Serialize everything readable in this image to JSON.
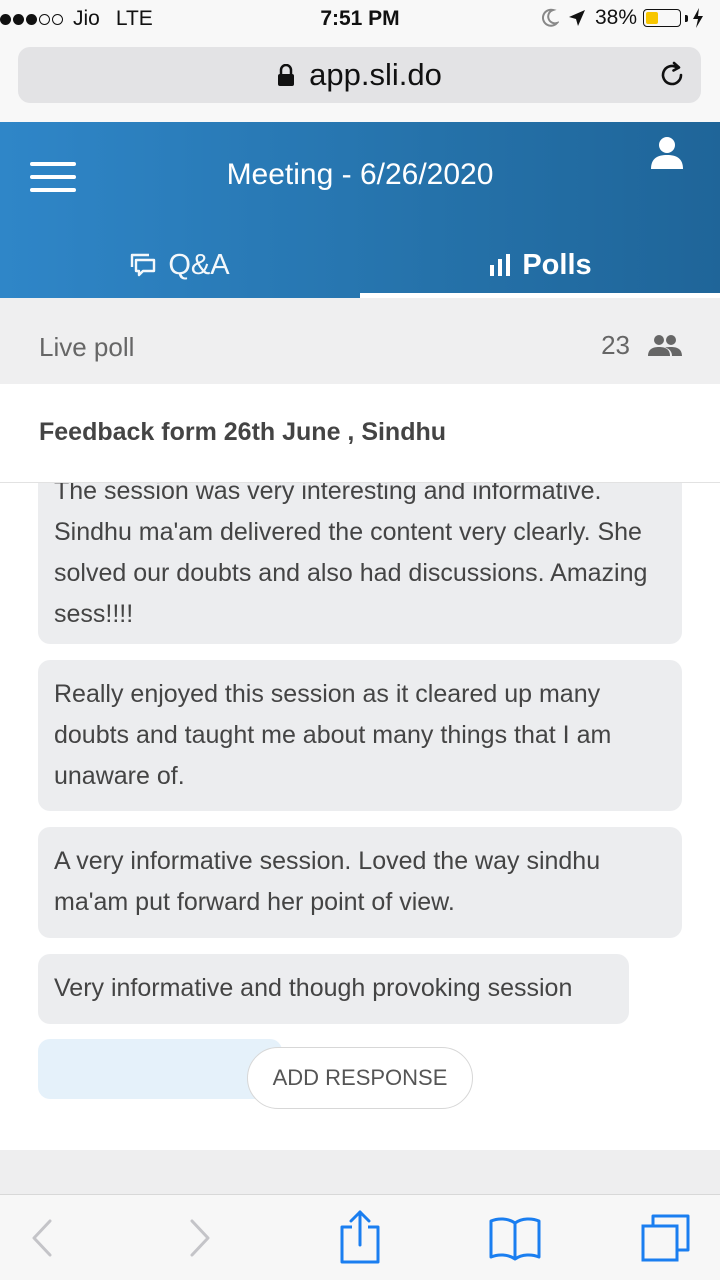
{
  "status_bar": {
    "carrier": "Jio",
    "network": "LTE",
    "time": "7:51 PM",
    "battery_percent": "38%",
    "battery_level": 0.38,
    "icons": [
      "moon-icon",
      "location-arrow-icon",
      "battery-icon",
      "charging-bolt-icon"
    ]
  },
  "browser": {
    "url": "app.sli.do"
  },
  "header": {
    "meeting_title": "Meeting - 6/26/2020",
    "tabs": [
      {
        "label": "Q&A",
        "icon": "chat-bubbles-icon",
        "active": false
      },
      {
        "label": "Polls",
        "icon": "bar-chart-icon",
        "active": true
      }
    ]
  },
  "poll": {
    "status_label": "Live poll",
    "participant_count": "23",
    "title": "Feedback form 26th June , Sindhu",
    "responses": [
      {
        "text": "The session was very interesting and informative. Sindhu ma'am delivered the content very clearly. She solved our doubts and also had discussions. Amazing sess!!!!"
      },
      {
        "text": "Really enjoyed this session as it cleared up many doubts and taught me about many things that I am unaware of."
      },
      {
        "text": "A very informative session. Loved the way sindhu ma'am put forward her point of view."
      },
      {
        "text": "Very informative and though provoking session"
      }
    ],
    "add_response_label": "ADD RESPONSE"
  },
  "colors": {
    "header_blue": "#2572aa",
    "response_bg": "#ecedef",
    "battery_fill": "#f7c600"
  }
}
